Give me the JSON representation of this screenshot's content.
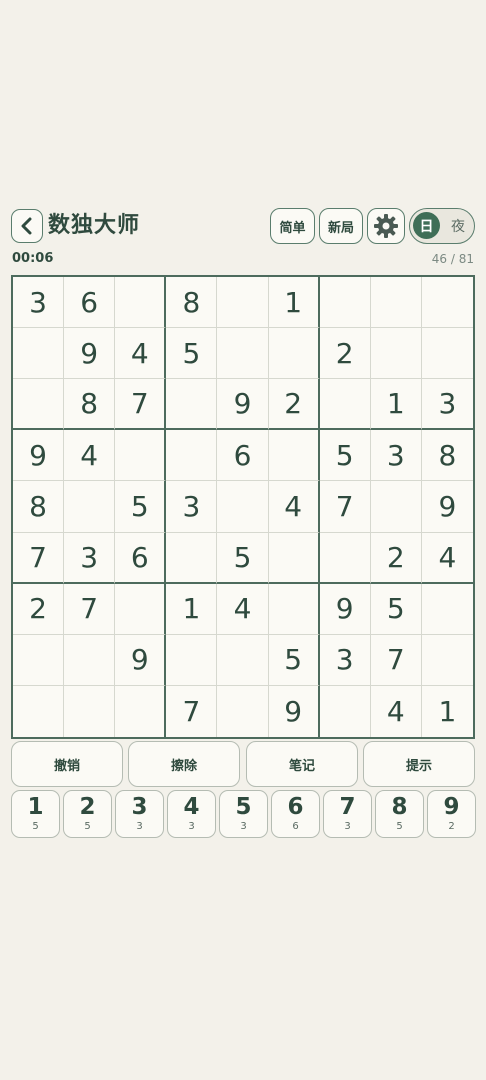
{
  "header": {
    "title": "数独大师",
    "difficulty_label": "简单",
    "new_game_label": "新局",
    "theme_day_label": "日",
    "theme_night_label": "夜",
    "icons": [
      "chevron-left-icon",
      "gear-icon"
    ]
  },
  "status": {
    "timer": "00:06",
    "progress": "46 / 81"
  },
  "board": [
    [
      "3",
      "6",
      "",
      "8",
      "",
      "1",
      "",
      "",
      ""
    ],
    [
      "",
      "9",
      "4",
      "5",
      "",
      "",
      "2",
      "",
      ""
    ],
    [
      "",
      "8",
      "7",
      "",
      "9",
      "2",
      "",
      "1",
      "3"
    ],
    [
      "9",
      "4",
      "",
      "",
      "6",
      "",
      "5",
      "3",
      "8"
    ],
    [
      "8",
      "",
      "5",
      "3",
      "",
      "4",
      "7",
      "",
      "9"
    ],
    [
      "7",
      "3",
      "6",
      "",
      "5",
      "",
      "",
      "2",
      "4"
    ],
    [
      "2",
      "7",
      "",
      "1",
      "4",
      "",
      "9",
      "5",
      ""
    ],
    [
      "",
      "",
      "9",
      "",
      "",
      "5",
      "3",
      "7",
      ""
    ],
    [
      "",
      "",
      "",
      "7",
      "",
      "9",
      "",
      "4",
      "1"
    ]
  ],
  "actions": {
    "undo": "撤销",
    "erase": "擦除",
    "notes": "笔记",
    "hint": "提示"
  },
  "numpad": [
    {
      "digit": "1",
      "remaining": "5"
    },
    {
      "digit": "2",
      "remaining": "5"
    },
    {
      "digit": "3",
      "remaining": "3"
    },
    {
      "digit": "4",
      "remaining": "3"
    },
    {
      "digit": "5",
      "remaining": "3"
    },
    {
      "digit": "6",
      "remaining": "6"
    },
    {
      "digit": "7",
      "remaining": "3"
    },
    {
      "digit": "8",
      "remaining": "5"
    },
    {
      "digit": "9",
      "remaining": "2"
    }
  ],
  "colors": {
    "background": "#f3f1ea",
    "accent": "#3f6e57",
    "text": "#2f4a3e",
    "board_border": "#4d6b5d"
  }
}
